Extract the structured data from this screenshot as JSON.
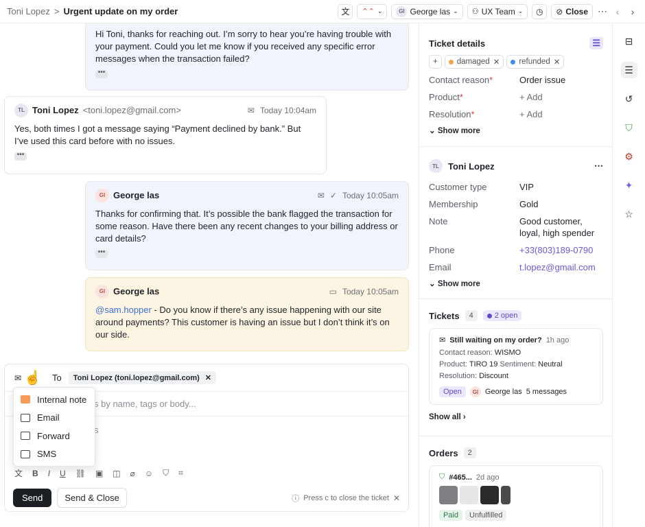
{
  "header": {
    "breadcrumb_parent": "Toni Lopez",
    "breadcrumb_sep": ">",
    "title": "Urgent update on my order",
    "assignee": "George las",
    "assignee_initials": "GI",
    "team": "UX Team",
    "close_label": "Close"
  },
  "messages": [
    {
      "text": "Hi Toni, thanks for reaching out. I’m sorry to hear you’re having trouble with your payment. Could you let me know if you received any specific error messages when the transaction failed?"
    },
    {
      "initials": "TL",
      "name": "Toni Lopez",
      "email": "<toni.lopez@gmail.com>",
      "time": "Today 10:04am",
      "text": "Yes, both times I got a message saying “Payment declined by bank.” But I’ve used this card before with no issues."
    },
    {
      "initials": "GI",
      "name": "George las",
      "time": "Today 10:05am",
      "text": "Thanks for confirming that. It’s possible the bank flagged the transaction for some reason. Have there been any recent changes to your billing address or card details?"
    },
    {
      "initials": "GI",
      "name": "George las",
      "time": "Today 10:05am",
      "mention": "@sam.hopper",
      "text": " - Do you know if there’s any issue happening with our site around payments? This customer is having an issue but I don’t think it’s on our side."
    }
  ],
  "composer": {
    "to_label": "To",
    "recipient": "Toni Lopez (toni.lopez@gmail.com)",
    "search_placeholder_visible": "s by name, tags or body...",
    "body_fragment": "s",
    "send_label": "Send",
    "send_close_label": "Send & Close",
    "hint": "Press c to close the ticket"
  },
  "channel_menu": {
    "items": [
      {
        "label": "Internal note",
        "icon": "note-icon"
      },
      {
        "label": "Email",
        "icon": "mail-icon"
      },
      {
        "label": "Forward",
        "icon": "forward-icon"
      },
      {
        "label": "SMS",
        "icon": "sms-icon"
      }
    ]
  },
  "ticket_details": {
    "title": "Ticket details",
    "tags": [
      {
        "label": "damaged",
        "color": "#f0a34b"
      },
      {
        "label": "refunded",
        "color": "#3f8ee6"
      }
    ],
    "fields": [
      {
        "label": "Contact reason",
        "value": "Order issue"
      },
      {
        "label": "Product",
        "value": "+ Add"
      },
      {
        "label": "Resolution",
        "value": "+ Add"
      }
    ],
    "show_more": "Show more"
  },
  "customer": {
    "initials": "TL",
    "name": "Toni Lopez",
    "fields": [
      {
        "label": "Customer type",
        "value": "VIP"
      },
      {
        "label": "Membership",
        "value": "Gold"
      },
      {
        "label": "Note",
        "value": "Good customer, loyal, high spender"
      },
      {
        "label": "Phone",
        "value": "+33(803)189-0790"
      },
      {
        "label": "Email",
        "value": "t.lopez@gmail.com"
      }
    ],
    "show_more": "Show more"
  },
  "tickets": {
    "title": "Tickets",
    "count": "4",
    "open_badge": "2 open",
    "card": {
      "title": "Still waiting on my order?",
      "age": "1h ago",
      "contact_reason_label": "Contact reason:",
      "contact_reason": "WISMO",
      "product_label": "Product:",
      "product": "TIRO 19",
      "sentiment_label": "Sentiment:",
      "sentiment": "Neutral",
      "resolution_label": "Resolution:",
      "resolution": "Discount",
      "status": "Open",
      "agent": "George las",
      "messages": "5 messages"
    },
    "show_all": "Show all"
  },
  "orders": {
    "title": "Orders",
    "count": "2",
    "card": {
      "id": "#465...",
      "age": "2d ago",
      "paid": "Paid",
      "fulfillment": "Unfulfilled"
    }
  }
}
